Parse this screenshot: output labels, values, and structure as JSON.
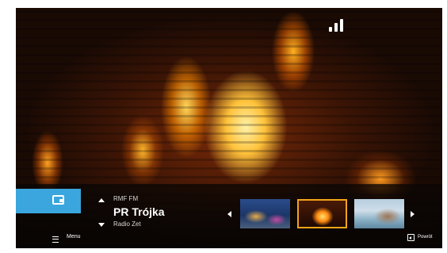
{
  "status_bar": {
    "signal_icon": "signal-strength-icon"
  },
  "wallet": {
    "icon": "wallet-icon",
    "color": "#3aa6dd"
  },
  "channels": {
    "previous": "RMF FM",
    "current": "PR Trójka",
    "next": "Radio Zet",
    "up_icon": "arrow-up-icon",
    "down_icon": "arrow-down-icon"
  },
  "carousel": {
    "prev_icon": "caret-left-icon",
    "next_icon": "caret-right-icon",
    "items": [
      {
        "name": "aquarium",
        "selected": false
      },
      {
        "name": "fireplace",
        "selected": true
      },
      {
        "name": "seaside cliffs",
        "selected": false
      }
    ],
    "highlight_color": "#f2a41a"
  },
  "footer": {
    "menu_label": "Menu",
    "menu_icon": "hamburger-menu-icon",
    "back_label": "Powrót",
    "back_icon": "back-icon"
  }
}
